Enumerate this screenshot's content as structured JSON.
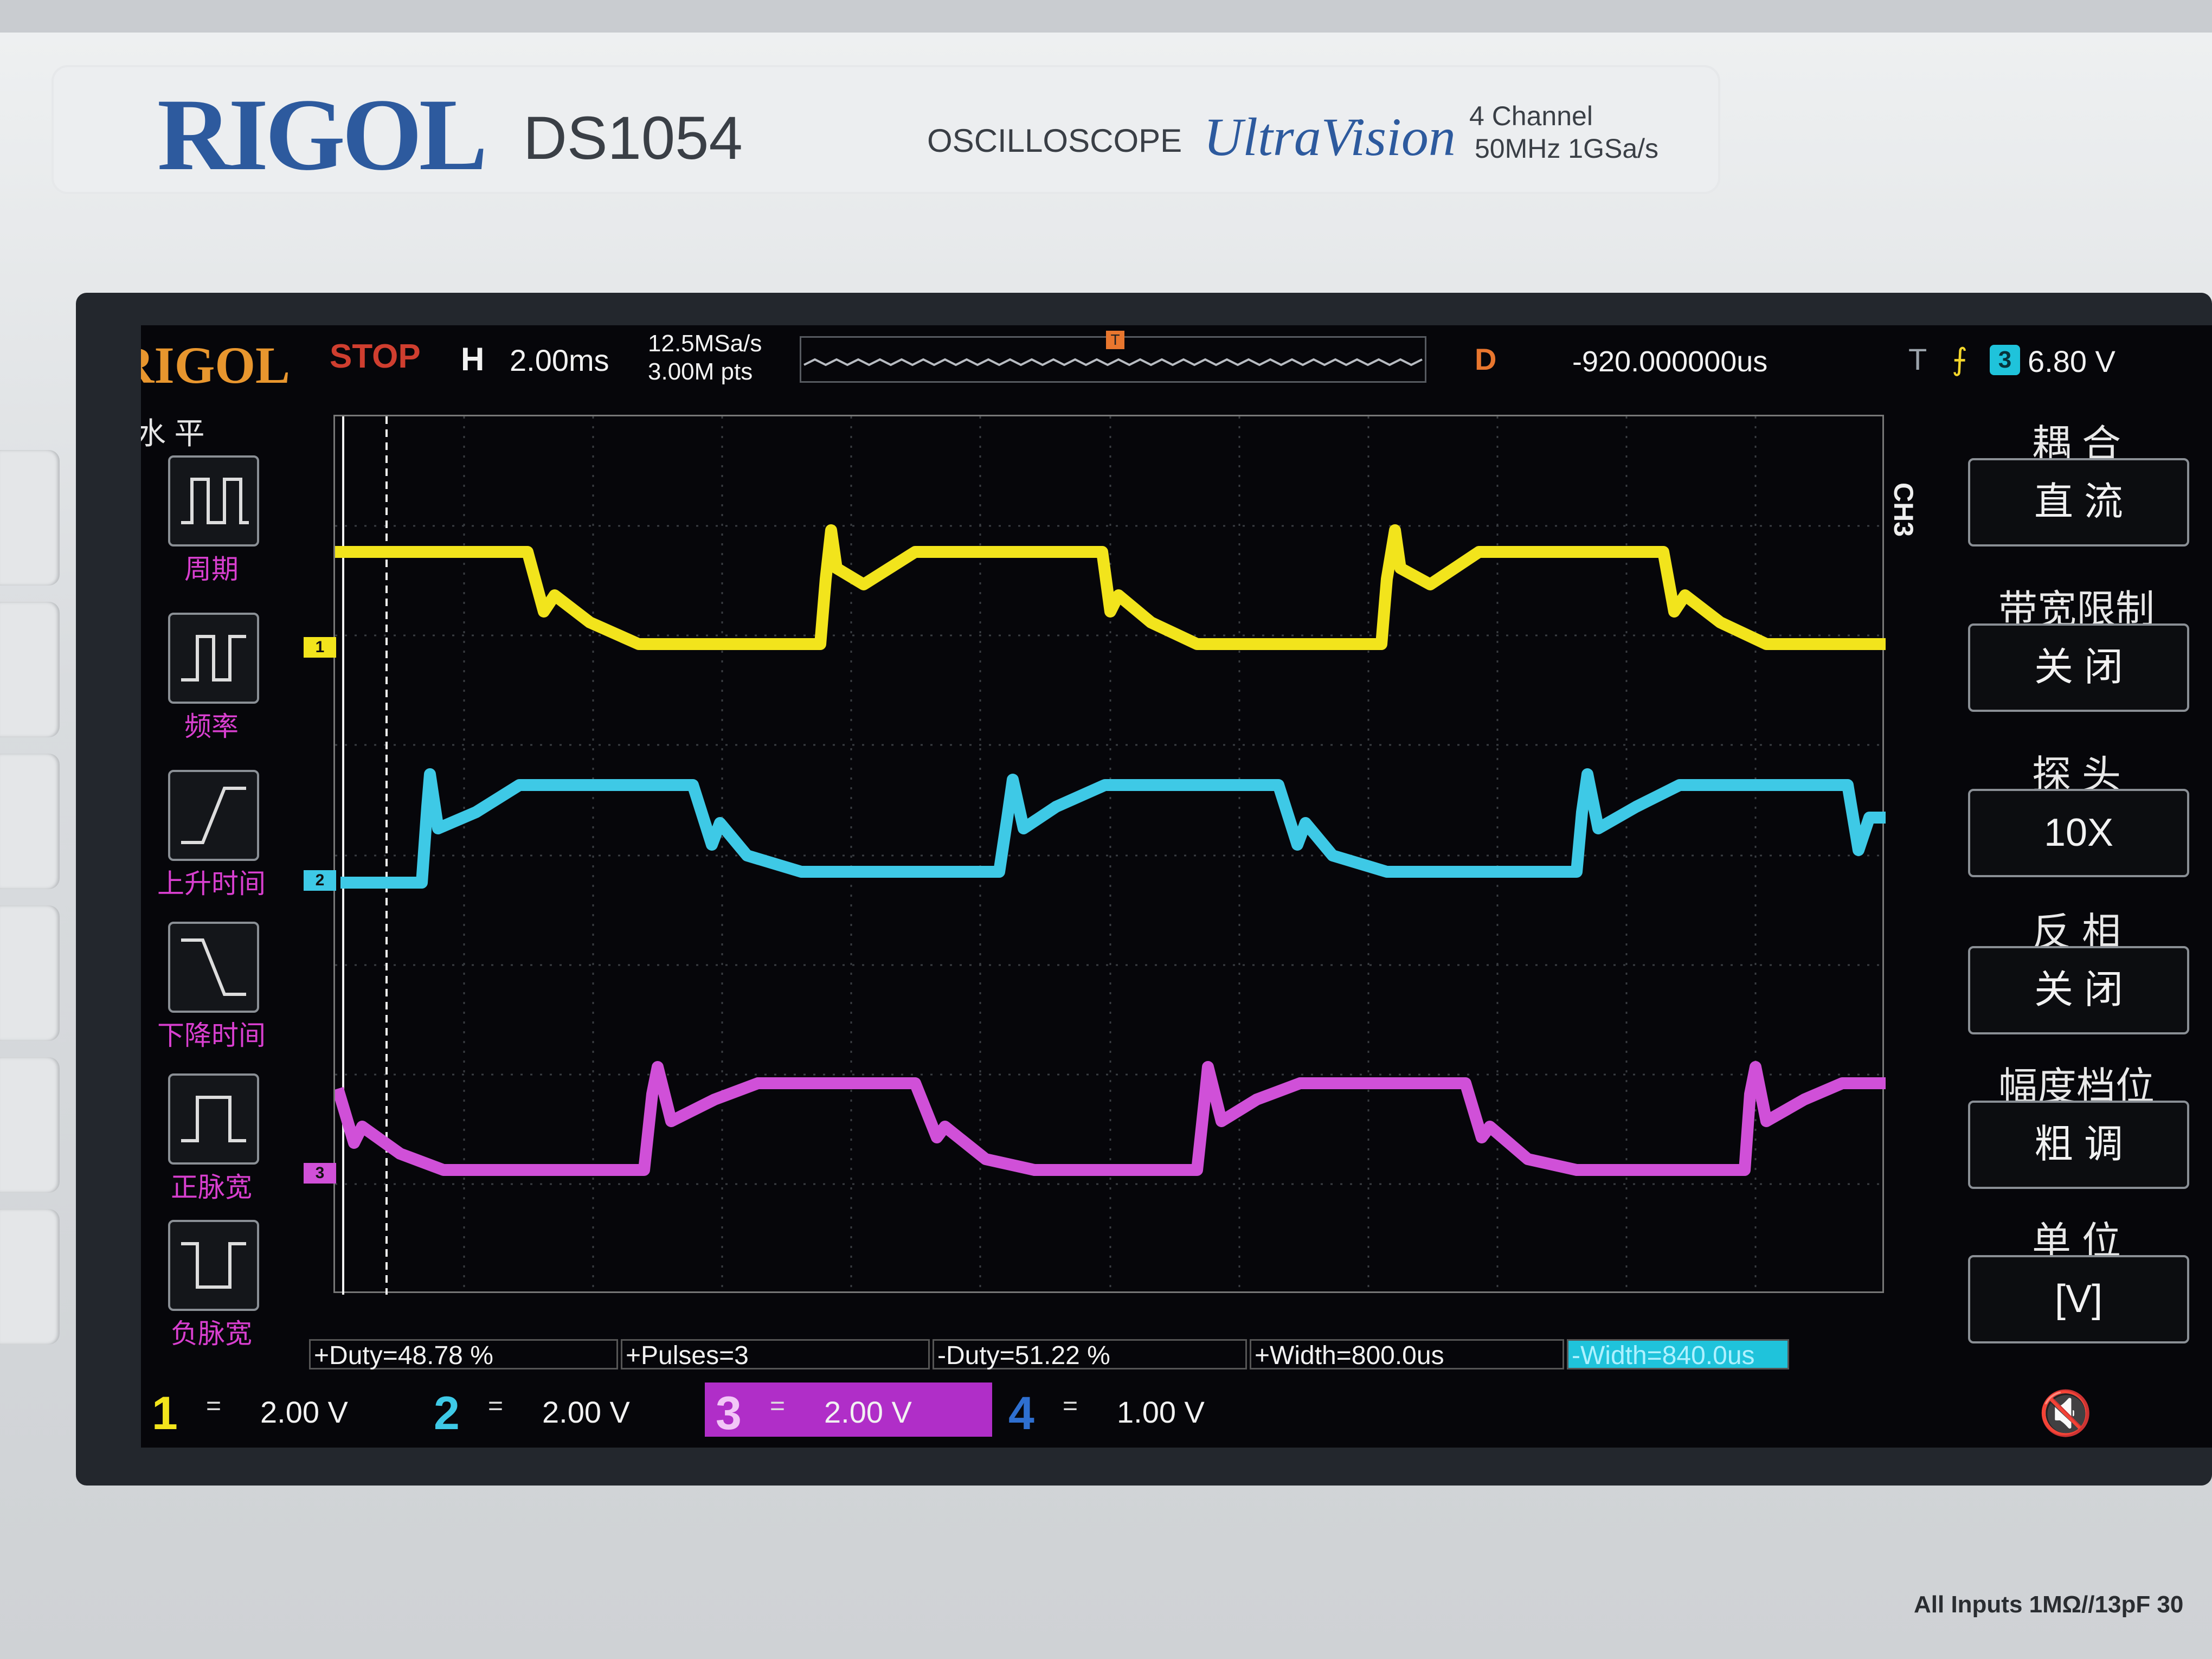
{
  "device": {
    "brand": "RIGOL",
    "model": "DS1054",
    "type": "OSCILLOSCOPE",
    "series": "UltraVision",
    "channels": "4 Channel",
    "spec": "50MHz  1GSa/s",
    "footer": "All Inputs 1MΩ//13pF 30"
  },
  "status": {
    "logo": "RIGOL",
    "run_state": "STOP",
    "h_label": "H",
    "timebase": "2.00ms",
    "sample_rate": "12.5MSa/s",
    "memory_depth": "3.00M pts",
    "trigger_marker": "T",
    "delay_label": "D",
    "delay": "-920.000000us",
    "trigger_label": "T",
    "trigger_edge": "rising",
    "trigger_source": "3",
    "trigger_level": "6.80 V"
  },
  "left_menu": {
    "title": "水 平",
    "items": [
      {
        "label": "周期",
        "icon": "period-icon"
      },
      {
        "label": "频率",
        "icon": "frequency-icon"
      },
      {
        "label": "上升时间",
        "icon": "rise-time-icon"
      },
      {
        "label": "下降时间",
        "icon": "fall-time-icon"
      },
      {
        "label": "正脉宽",
        "icon": "positive-pulse-width-icon"
      },
      {
        "label": "负脉宽",
        "icon": "negative-pulse-width-icon"
      }
    ]
  },
  "right_menu": {
    "channel": "CH3",
    "items": [
      {
        "title": "耦 合",
        "value": "直 流"
      },
      {
        "title": "带宽限制",
        "value": "关 闭"
      },
      {
        "title": "探 头",
        "value": "10X"
      },
      {
        "title": "反 相",
        "value": "关 闭"
      },
      {
        "title": "幅度档位",
        "value": "粗 调"
      },
      {
        "title": "单 位",
        "value": "[V]"
      }
    ]
  },
  "waveform_markers": {
    "ch1": "1",
    "ch2": "2",
    "ch3": "3"
  },
  "measurements": [
    "+Duty=48.78 %",
    "+Pulses=3",
    "-Duty=51.22 %",
    "+Width=800.0us",
    "-Width=840.0us"
  ],
  "channels": [
    {
      "num": "1",
      "coupling": "=",
      "scale": "2.00 V",
      "color": "#f2e41c"
    },
    {
      "num": "2",
      "coupling": "=",
      "scale": "2.00 V",
      "color": "#3ec9e6"
    },
    {
      "num": "3",
      "coupling": "=",
      "scale": "2.00 V",
      "color": "#d050d8"
    },
    {
      "num": "4",
      "coupling": "=",
      "scale": "1.00 V",
      "color": "#2e6fd0"
    }
  ],
  "colors": {
    "ch1": "#f2e41c",
    "ch2": "#3ec9e6",
    "ch3": "#d050d8",
    "ch4": "#2e6fd0",
    "stop": "#cf3e2f",
    "accent": "#e8962e"
  }
}
